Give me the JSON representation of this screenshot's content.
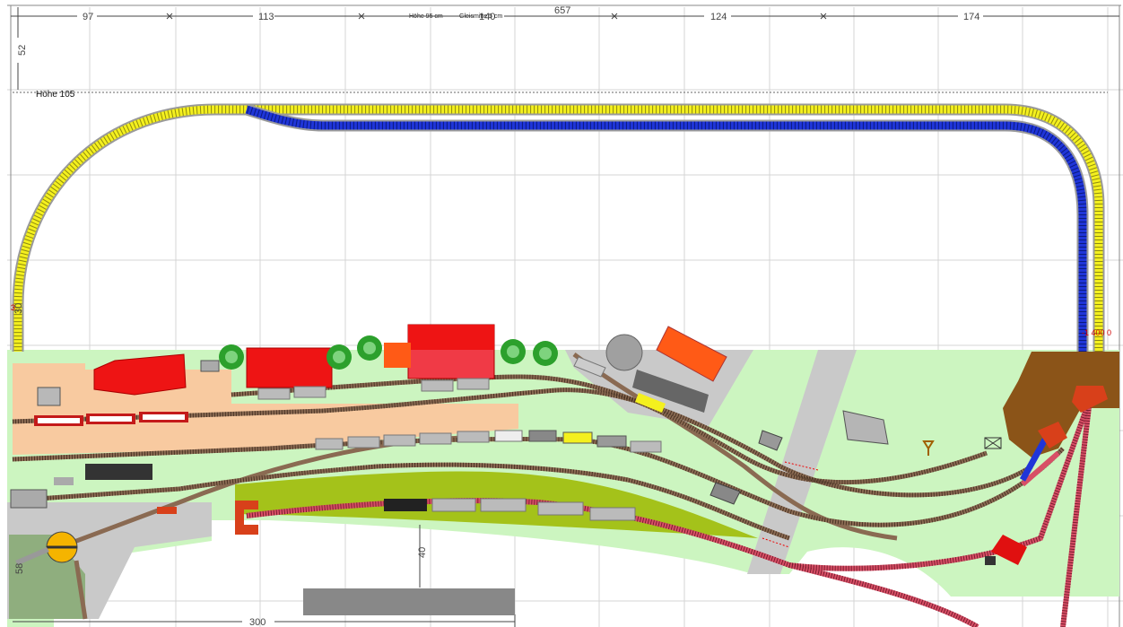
{
  "plan": {
    "top_dimensions": [
      "97",
      "113",
      "140",
      "124",
      "174"
    ],
    "total_width_label": "657",
    "left_top_dimension": "52",
    "left_mid_dimension": "30",
    "left_bottom_dimension": "58",
    "bottom_dimension": "300",
    "platform_gap_dimension": "40",
    "height_label_left": "Höhe 105",
    "height_label_small": "Höhe 95 cm",
    "gauge_label_small": "Gleismitte 5 cm",
    "red_marker_right": "-1 400 0",
    "red_marker_left": "3"
  },
  "colors": {
    "yellow_track": "#f4f01e",
    "blue_track": "#1f35d8",
    "red_track": "#d84f66",
    "brown_track": "#8a6a52",
    "grass": "#ccf5c0",
    "sand": "#f8caa0",
    "roof_red": "#ee1414",
    "roof_orange": "#ff5a16",
    "mountain": "#8b5418",
    "road": "#c8c8c8",
    "olive": "#a4c21a"
  }
}
